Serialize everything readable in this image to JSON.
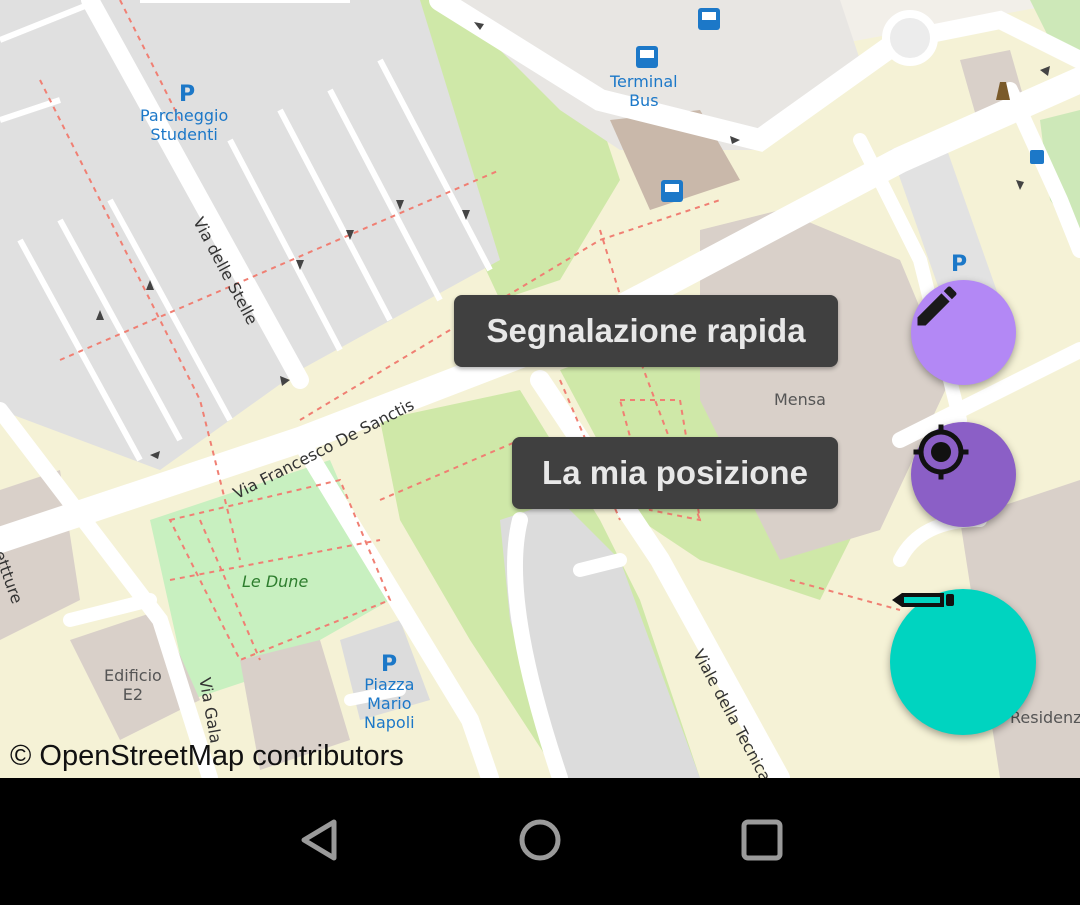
{
  "map": {
    "labels": {
      "parcheggio": "Parcheggio\nStudenti",
      "terminal": "Terminal\nBus",
      "mensa": "Mensa",
      "le_dune": "Le Dune",
      "edificio": "Edificio\nE2",
      "piazza": "Piazza\nMario\nNapoli",
      "residenze": "Residenz",
      "architetture": "ettture",
      "via_stelle": "Via delle Stelle",
      "via_de_sanctis": "Via Francesco De Sanctis",
      "viale_tecnica": "Viale della Tecnica",
      "via_gala": "Via Gala"
    },
    "parking_symbol": "P",
    "attribution": "© OpenStreetMap contributors"
  },
  "actions": {
    "quick_report_label": "Segnalazione rapida",
    "my_location_label": "La mia posizione"
  },
  "icons": {
    "quick_report": "pencil-icon",
    "my_location": "crosshair-icon",
    "main_fab": "pen-icon",
    "back": "back-triangle-icon",
    "home": "home-circle-icon",
    "recents": "recents-square-icon"
  },
  "colors": {
    "quick_report_fab": "#b388f5",
    "my_location_fab": "#8b5fc6",
    "main_fab": "#00d4c0",
    "tooltip_bg": "#404040"
  }
}
